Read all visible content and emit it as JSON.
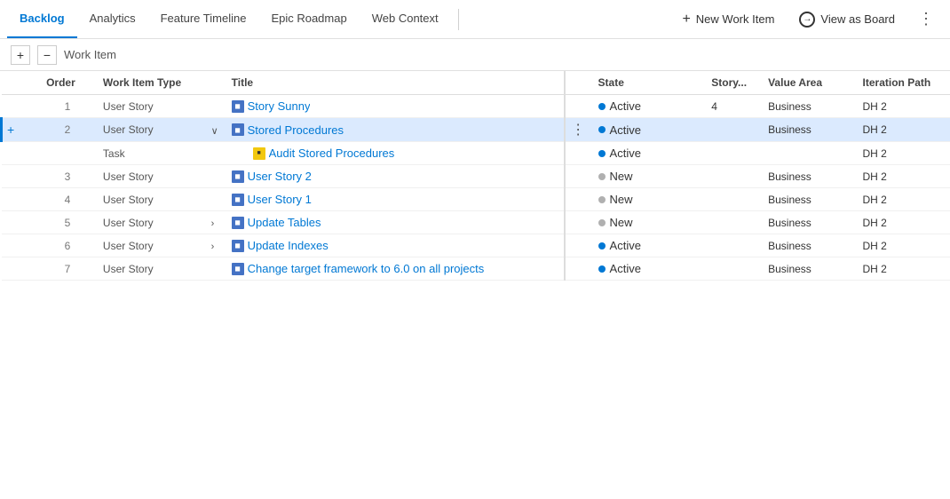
{
  "nav": {
    "tabs": [
      {
        "id": "backlog",
        "label": "Backlog",
        "active": true
      },
      {
        "id": "analytics",
        "label": "Analytics",
        "active": false
      },
      {
        "id": "feature-timeline",
        "label": "Feature Timeline",
        "active": false
      },
      {
        "id": "epic-roadmap",
        "label": "Epic Roadmap",
        "active": false
      },
      {
        "id": "web-context",
        "label": "Web Context",
        "active": false
      }
    ],
    "new_work_item_label": "New Work Item",
    "view_as_board_label": "View as Board",
    "more_options_label": "⋯"
  },
  "toolbar": {
    "add_label": "+",
    "remove_label": "−",
    "work_item_label": "Work Item"
  },
  "table": {
    "columns": [
      {
        "id": "action",
        "label": ""
      },
      {
        "id": "order",
        "label": "Order"
      },
      {
        "id": "work_item_type",
        "label": "Work Item Type"
      },
      {
        "id": "expand",
        "label": ""
      },
      {
        "id": "title",
        "label": "Title"
      },
      {
        "id": "actions",
        "label": ""
      },
      {
        "id": "state",
        "label": "State"
      },
      {
        "id": "story_points",
        "label": "Story..."
      },
      {
        "id": "value_area",
        "label": "Value Area"
      },
      {
        "id": "iteration_path",
        "label": "Iteration Path"
      }
    ],
    "rows": [
      {
        "id": 1,
        "order": "1",
        "work_item_type": "User Story",
        "icon_type": "user-story",
        "expand": "",
        "title": "Story Sunny",
        "state": "Active",
        "state_type": "active",
        "story_points": "4",
        "value_area": "Business",
        "iteration_path": "DH 2",
        "selected": false,
        "has_children": false
      },
      {
        "id": 2,
        "order": "2",
        "work_item_type": "User Story",
        "icon_type": "user-story",
        "expand": "expanded",
        "title": "Stored Procedures",
        "state": "Active",
        "state_type": "active",
        "story_points": "",
        "value_area": "Business",
        "iteration_path": "DH 2",
        "selected": true,
        "has_children": true,
        "show_more": true
      },
      {
        "id": "2a",
        "order": "",
        "work_item_type": "Task",
        "icon_type": "task",
        "expand": "",
        "title": "Audit Stored Procedures",
        "state": "Active",
        "state_type": "active",
        "story_points": "",
        "value_area": "",
        "iteration_path": "DH 2",
        "selected": false,
        "has_children": false,
        "is_child": true
      },
      {
        "id": 3,
        "order": "3",
        "work_item_type": "User Story",
        "icon_type": "user-story",
        "expand": "",
        "title": "User Story 2",
        "state": "New",
        "state_type": "new",
        "story_points": "",
        "value_area": "Business",
        "iteration_path": "DH 2",
        "selected": false,
        "has_children": false
      },
      {
        "id": 4,
        "order": "4",
        "work_item_type": "User Story",
        "icon_type": "user-story",
        "expand": "",
        "title": "User Story 1",
        "state": "New",
        "state_type": "new",
        "story_points": "",
        "value_area": "Business",
        "iteration_path": "DH 2",
        "selected": false,
        "has_children": false
      },
      {
        "id": 5,
        "order": "5",
        "work_item_type": "User Story",
        "icon_type": "user-story",
        "expand": "collapsed",
        "title": "Update Tables",
        "state": "New",
        "state_type": "new",
        "story_points": "",
        "value_area": "Business",
        "iteration_path": "DH 2",
        "selected": false,
        "has_children": true
      },
      {
        "id": 6,
        "order": "6",
        "work_item_type": "User Story",
        "icon_type": "user-story",
        "expand": "collapsed",
        "title": "Update Indexes",
        "state": "Active",
        "state_type": "active",
        "story_points": "",
        "value_area": "Business",
        "iteration_path": "DH 2",
        "selected": false,
        "has_children": true
      },
      {
        "id": 7,
        "order": "7",
        "work_item_type": "User Story",
        "icon_type": "user-story",
        "expand": "",
        "title": "Change target framework to 6.0 on all projects",
        "state": "Active",
        "state_type": "active",
        "story_points": "",
        "value_area": "Business",
        "iteration_path": "DH 2",
        "selected": false,
        "has_children": false
      }
    ]
  }
}
